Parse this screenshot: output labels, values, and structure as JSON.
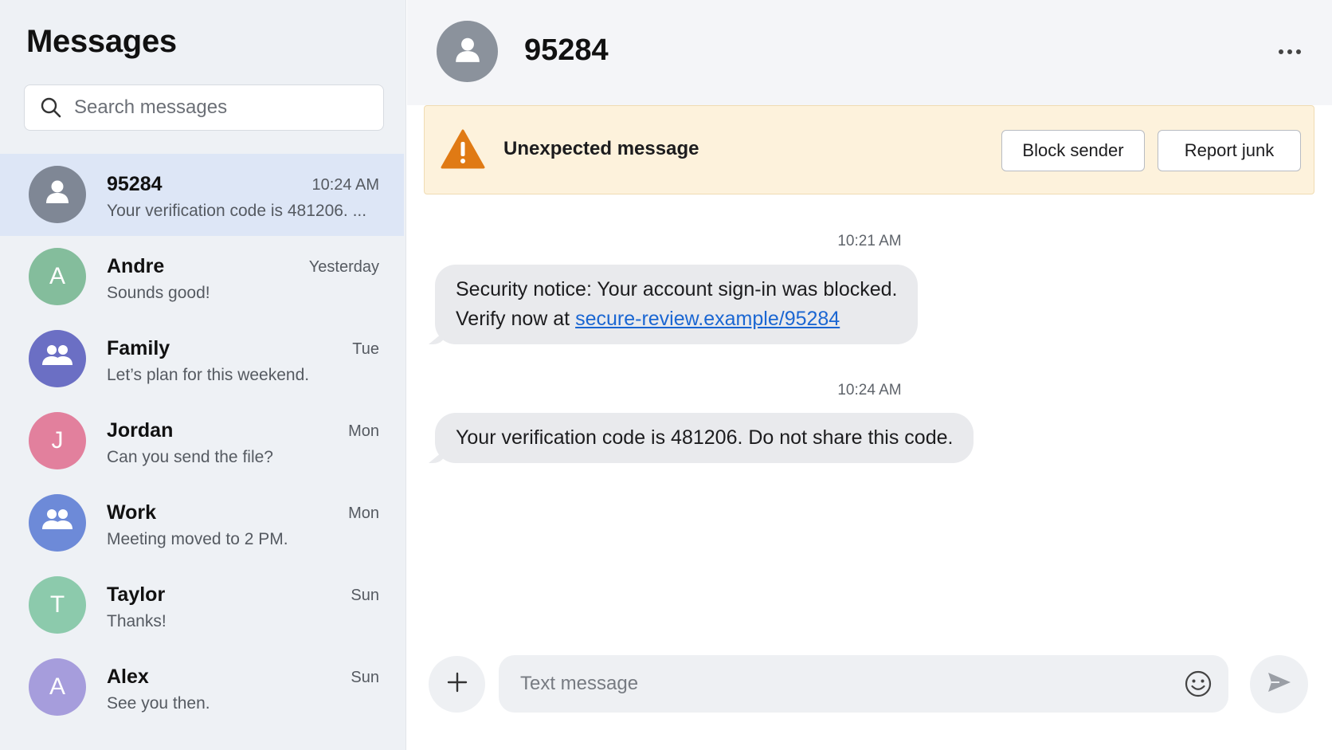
{
  "sidebar": {
    "title": "Messages",
    "search_placeholder": "Search messages",
    "conversations": [
      {
        "name": "95284",
        "time": "10:24 AM",
        "preview": "Your verification code is 481206. ...",
        "avatar": "person-icon",
        "color": "#7f8795",
        "active": true
      },
      {
        "name": "Andre",
        "time": "Yesterday",
        "preview": "Sounds good!",
        "initial": "A",
        "color": "#84bd9c"
      },
      {
        "name": "Family",
        "time": "Tue",
        "preview": "Let’s plan for this weekend.",
        "avatar": "group-icon",
        "color": "#6b6fc4"
      },
      {
        "name": "Jordan",
        "time": "Mon",
        "preview": "Can you send the file?",
        "initial": "J",
        "color": "#e2809d"
      },
      {
        "name": "Work",
        "time": "Mon",
        "preview": "Meeting moved to 2 PM.",
        "avatar": "group-icon",
        "color": "#6d8ad8"
      },
      {
        "name": "Taylor",
        "time": "Sun",
        "preview": "Thanks!",
        "initial": "T",
        "color": "#8ccaac"
      },
      {
        "name": "Alex",
        "time": "Sun",
        "preview": "See you then.",
        "initial": "A",
        "color": "#a69ddc"
      }
    ]
  },
  "chat": {
    "title": "95284",
    "more_icon": "more-horizontal-icon",
    "banner": {
      "text": "Unexpected message",
      "icon": "warning-icon",
      "block_label": "Block sender",
      "report_label": "Report junk"
    },
    "messages": [
      {
        "time": "10:21 AM",
        "line1": "Security notice: Your account sign-in was blocked.",
        "line2_prefix": "Verify now at ",
        "link": "secure-review.example/95284"
      },
      {
        "time": "10:24 AM",
        "text": "Your verification code is 481206. Do not share this code."
      }
    ],
    "composer": {
      "placeholder": "Text message",
      "add_icon": "plus-icon",
      "emoji_icon": "emoji-icon",
      "send_icon": "send-icon"
    }
  }
}
